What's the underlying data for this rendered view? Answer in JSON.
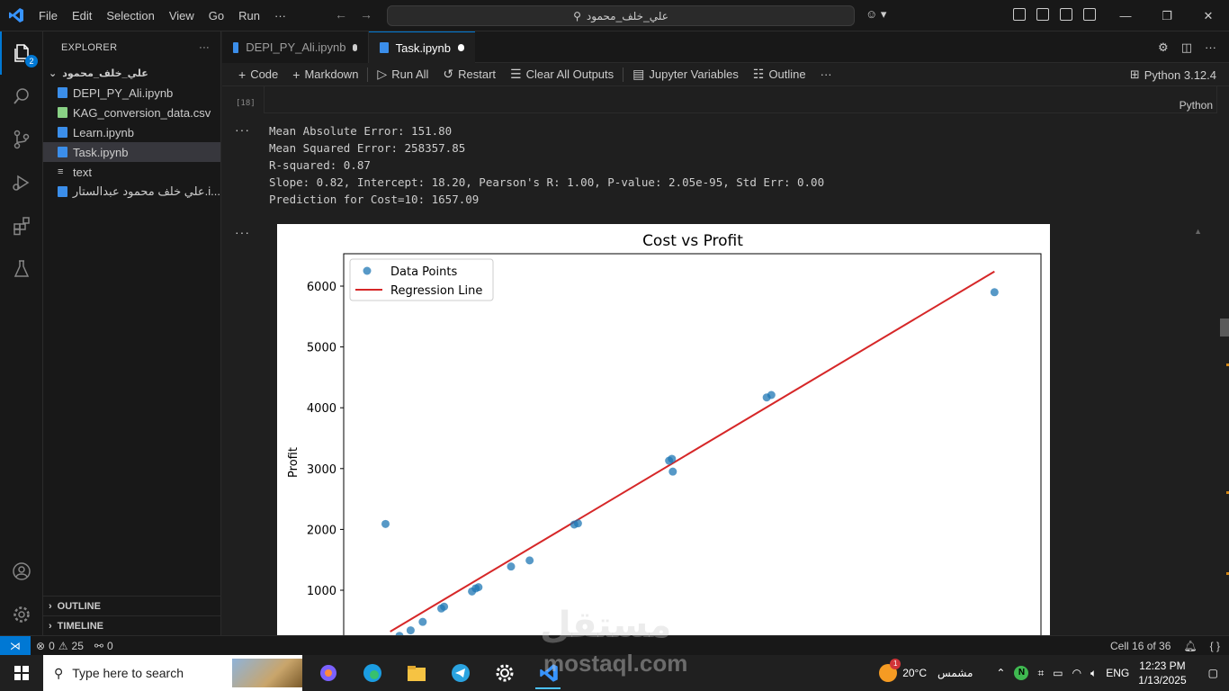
{
  "titlebar": {
    "menu": [
      "File",
      "Edit",
      "Selection",
      "View",
      "Go",
      "Run",
      "···"
    ],
    "search_text": "علي_خلف_محمود"
  },
  "activity": {
    "explorer_badge": "2"
  },
  "explorer": {
    "title": "EXPLORER",
    "more": "···",
    "folder": "علي_خلف_محمود",
    "files": [
      {
        "name": "DEPI_PY_Ali.ipynb",
        "kind": "notebook"
      },
      {
        "name": "KAG_conversion_data.csv",
        "kind": "csv"
      },
      {
        "name": "Learn.ipynb",
        "kind": "notebook"
      },
      {
        "name": "Task.ipynb",
        "kind": "notebook"
      },
      {
        "name": "text",
        "kind": "text"
      },
      {
        "name": "علي خلف محمود عبدالستار.i...",
        "kind": "notebook"
      }
    ],
    "outline": "OUTLINE",
    "timeline": "TIMELINE"
  },
  "tabs": [
    {
      "label": "DEPI_PY_Ali.ipynb"
    },
    {
      "label": "Task.ipynb"
    }
  ],
  "toolbar": {
    "code": "Code",
    "markdown": "Markdown",
    "run_all": "Run All",
    "restart": "Restart",
    "clear_outputs": "Clear All Outputs",
    "variables": "Jupyter Variables",
    "outline": "Outline",
    "more": "···",
    "kernel": "Python 3.12.4"
  },
  "cell": {
    "exec_count": "[18]",
    "language": "Python",
    "output_lines": [
      "Mean Absolute Error: 151.80",
      "Mean Squared Error: 258357.85",
      "R-squared: 0.87",
      "Slope: 0.82, Intercept: 18.20, Pearson's R: 1.00, P-value: 2.05e-95, Std Err: 0.00",
      "Prediction for Cost=10: 1657.09"
    ]
  },
  "chart_data": {
    "type": "scatter",
    "title": "Cost vs Profit",
    "xlabel": "",
    "ylabel": "Profit",
    "yticks": [
      1000,
      2000,
      3000,
      4000,
      5000,
      6000
    ],
    "ylim": [
      0,
      6500
    ],
    "xlim": [
      0,
      7500
    ],
    "legend": {
      "position": "top-left",
      "entries": [
        "Data Points",
        "Regression Line"
      ]
    },
    "colors": {
      "points": "#1f77b4",
      "line": "#d62728"
    },
    "series": [
      {
        "name": "Data Points",
        "points": [
          [
            450,
            2090
          ],
          [
            600,
            250
          ],
          [
            720,
            340
          ],
          [
            850,
            480
          ],
          [
            1050,
            700
          ],
          [
            1080,
            730
          ],
          [
            1380,
            980
          ],
          [
            1420,
            1030
          ],
          [
            1450,
            1050
          ],
          [
            1800,
            1390
          ],
          [
            2000,
            1490
          ],
          [
            2480,
            2080
          ],
          [
            2520,
            2100
          ],
          [
            3500,
            3130
          ],
          [
            3530,
            3160
          ],
          [
            3540,
            2950
          ],
          [
            4550,
            4170
          ],
          [
            4600,
            4210
          ],
          [
            7000,
            5900
          ]
        ]
      },
      {
        "name": "Regression Line",
        "line": [
          [
            500,
            320
          ],
          [
            7000,
            6240
          ]
        ]
      }
    ]
  },
  "status": {
    "errors": "0",
    "warnings": "25",
    "ports": "0",
    "cell_position": "Cell 16 of 36"
  },
  "taskbar": {
    "search_placeholder": "Type here to search",
    "weather_temp": "20°C",
    "weather_desc": "مشمس",
    "weather_badge": "1",
    "language": "ENG",
    "time": "12:23 PM",
    "date": "1/13/2025"
  },
  "watermark": {
    "ar": "مستقل",
    "en": "mostaql.com"
  }
}
